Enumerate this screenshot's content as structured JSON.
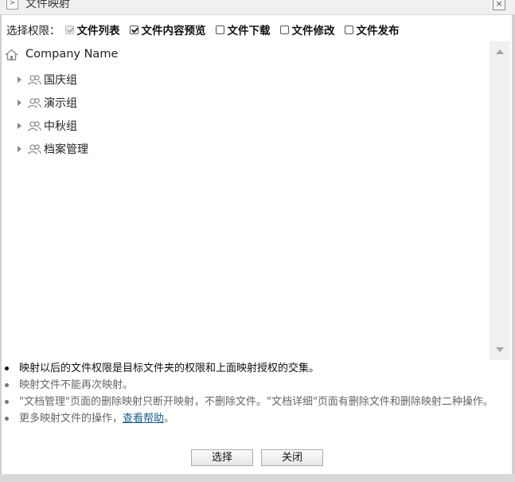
{
  "window": {
    "title": "文件映射",
    "expand_glyph": ">",
    "close_glyph": "×"
  },
  "permissions": {
    "label": "选择权限：",
    "options": [
      {
        "label": "文件列表",
        "checked": true,
        "disabled": true
      },
      {
        "label": "文件内容预览",
        "checked": true,
        "disabled": false
      },
      {
        "label": "文件下载",
        "checked": false,
        "disabled": false
      },
      {
        "label": "文件修改",
        "checked": false,
        "disabled": false
      },
      {
        "label": "文件发布",
        "checked": false,
        "disabled": false
      }
    ]
  },
  "tree": {
    "root": {
      "label": "Company Name",
      "icon": "home-icon"
    },
    "groups": [
      {
        "label": "国庆组",
        "icon": "group-icon"
      },
      {
        "label": "演示组",
        "icon": "group-icon"
      },
      {
        "label": "中秋组",
        "icon": "group-icon"
      },
      {
        "label": "档案管理",
        "icon": "group-icon"
      }
    ]
  },
  "notes": {
    "note1": "映射以后的文件权限是目标文件夹的权限和上面映射授权的交集。",
    "note2": "映射文件不能再次映射。",
    "note3": "\"文档管理\"页面的删除映射只断开映射，不删除文件。\"文档详细\"页面有删除文件和删除映射二种操作。",
    "note4_prefix": "更多映射文件的操作，",
    "note4_link": "查看帮助",
    "note4_suffix": "。"
  },
  "buttons": {
    "select": "选择",
    "close": "关闭"
  }
}
